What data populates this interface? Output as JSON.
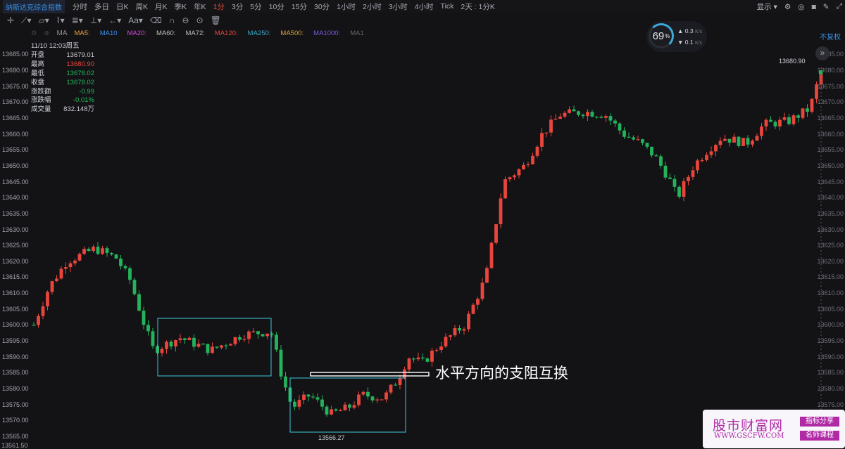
{
  "header": {
    "symbol": "纳斯达克综合指数",
    "timeframes": [
      "分时",
      "多日",
      "日K",
      "周K",
      "月K",
      "季K",
      "年K",
      "1分",
      "3分",
      "5分",
      "10分",
      "15分",
      "30分",
      "1小时",
      "2小时",
      "3小时",
      "4小时",
      "Tick",
      "2天 : 1分K"
    ],
    "active_timeframe": "1分",
    "display_label": "显示"
  },
  "ma_bar": {
    "toggle": "MA",
    "items": [
      {
        "label": "MA5:",
        "color": "#e8a33a"
      },
      {
        "label": "MA10",
        "color": "#3a8ee6"
      },
      {
        "label": "MA20:",
        "color": "#d14ad0"
      },
      {
        "label": "MA60:",
        "color": "#bfbfbf"
      },
      {
        "label": "MA72:",
        "color": "#bfbfbf"
      },
      {
        "label": "MA120:",
        "color": "#e8453c"
      },
      {
        "label": "MA250:",
        "color": "#3aa7c9"
      },
      {
        "label": "MA500:",
        "color": "#d8a43a"
      },
      {
        "label": "MA1000:",
        "color": "#7c58d8"
      },
      {
        "label": "MA1",
        "color": "#666666"
      }
    ]
  },
  "info": {
    "datetime": "11/10 12:03周五",
    "rows": [
      {
        "k": "开盘",
        "v": "13679.01",
        "c": "v"
      },
      {
        "k": "最高",
        "v": "13680.90",
        "c": "r"
      },
      {
        "k": "最低",
        "v": "13678.02",
        "c": "g"
      },
      {
        "k": "收盘",
        "v": "13678.02",
        "c": "g"
      },
      {
        "k": "涨跌额",
        "v": "-0.99",
        "c": "g"
      },
      {
        "k": "涨跌幅",
        "v": "-0.01%",
        "c": "g"
      },
      {
        "k": "成交量",
        "v": "832.148万",
        "c": "v"
      }
    ]
  },
  "speed": {
    "percent": "69",
    "unit": "%",
    "up": "0.3",
    "down": "0.1",
    "rate_unit": "K/s"
  },
  "fuquan": "不复权",
  "last_price_label": "13680.90",
  "low_price_label": "13566.27",
  "bottom_price_label": "13561.50",
  "annotation": "水平方向的支阻互换",
  "watermark": {
    "title": "股市财富网",
    "url": "WWW.GSCFW.COM",
    "tag1": "指标分享",
    "tag2": "名师课程"
  },
  "colors": {
    "up": "#e8453c",
    "down": "#24b35b",
    "box": "#3fc7d8",
    "bg": "#131316"
  },
  "chart_data": {
    "type": "candlestick",
    "y_ticks": [
      13685,
      13680,
      13675,
      13670,
      13665,
      13660,
      13655,
      13650,
      13645,
      13640,
      13635,
      13630,
      13625,
      13620,
      13615,
      13610,
      13605,
      13600,
      13595,
      13590,
      13585,
      13580,
      13575,
      13570,
      13565
    ],
    "y_range": [
      13562,
      13688
    ]
  }
}
